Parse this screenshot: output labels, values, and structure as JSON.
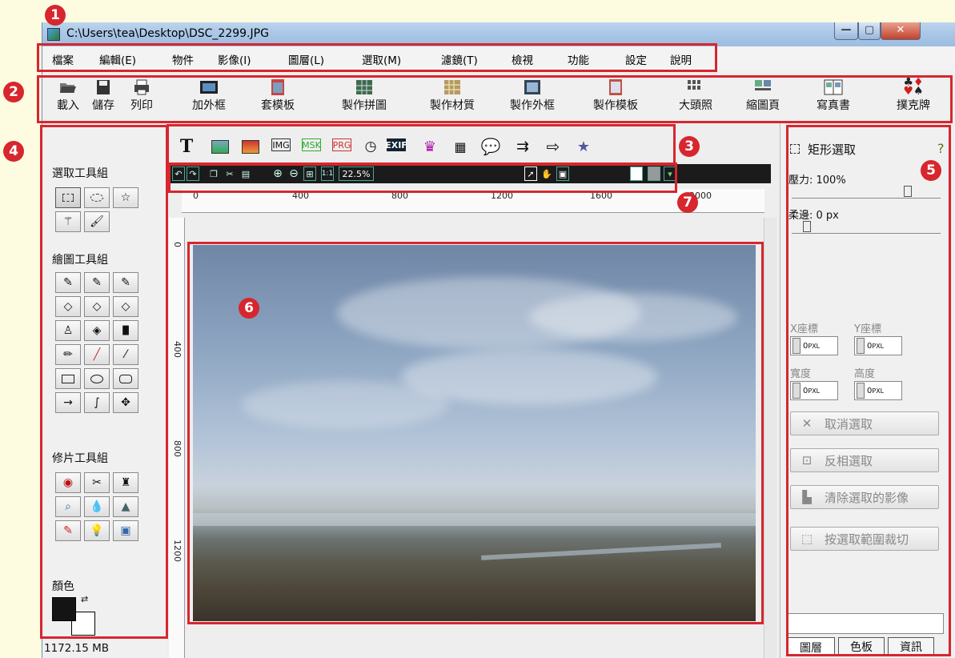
{
  "window": {
    "title": "C:\\Users\\tea\\Desktop\\DSC_2299.JPG"
  },
  "menu": [
    "檔案",
    "編輯(E)",
    "物件",
    "影像(I)",
    "圖層(L)",
    "選取(M)",
    "濾鏡(T)",
    "檢視",
    "功能",
    "設定",
    "說明"
  ],
  "toolbar": [
    "載入",
    "儲存",
    "列印",
    "加外框",
    "套模板",
    "製作拼圖",
    "製作材質",
    "製作外框",
    "製作模板",
    "大頭照",
    "縮圖頁",
    "寫真書",
    "撲克牌"
  ],
  "left_panel": {
    "selection_group": "選取工具組",
    "drawing_group": "繪圖工具組",
    "retouch_group": "修片工具組",
    "color_label": "顏色"
  },
  "status": {
    "memory": "1172.15 MB"
  },
  "nav": {
    "zoom": "22.5%"
  },
  "ruler": {
    "h_ticks": [
      "0",
      "400",
      "800",
      "1200",
      "1600",
      "2000"
    ],
    "v_ticks": [
      "0",
      "400",
      "800",
      "1200"
    ]
  },
  "right_panel": {
    "tool_title": "矩形選取",
    "pressure": "壓力: 100%",
    "feather": "柔邊: 0 px",
    "x_label": "X座標",
    "y_label": "Y座標",
    "width_label": "寬度",
    "height_label": "高度",
    "x_value": "0",
    "y_value": "0",
    "w_value": "0",
    "h_value": "0",
    "unit": "PXL",
    "cancel_selection": "取消選取",
    "invert_selection": "反相選取",
    "clear_selection": "清除選取的影像",
    "crop_selection": "按選取範圍裁切",
    "tabs": [
      "圖層",
      "色板",
      "資訊"
    ]
  },
  "annotations": [
    "1",
    "2",
    "3",
    "4",
    "5",
    "6",
    "7"
  ],
  "colors": {
    "annotation": "#d7262e",
    "title_bar": "#a9c6e6"
  }
}
